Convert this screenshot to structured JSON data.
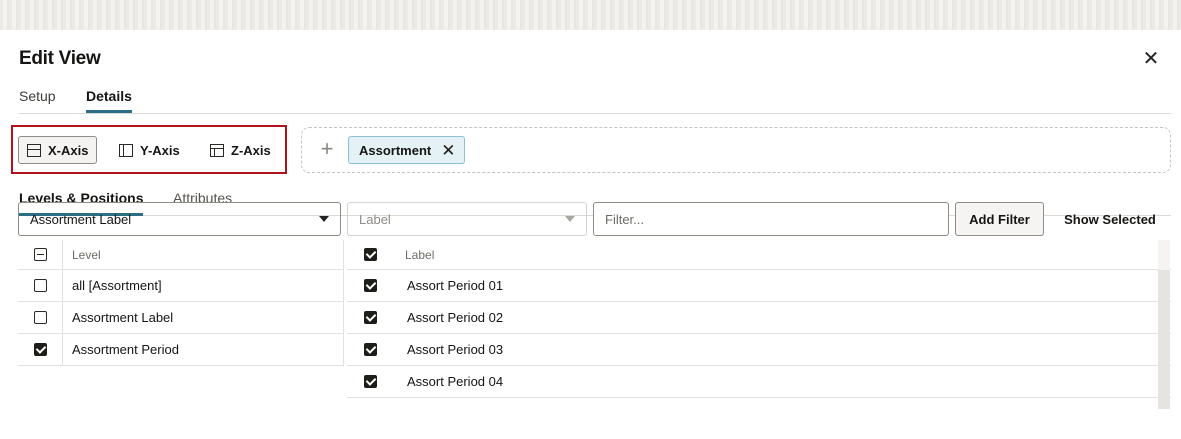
{
  "dialog": {
    "title": "Edit View",
    "close_symbol": "✕"
  },
  "main_tabs": [
    {
      "label": "Setup",
      "selected": false
    },
    {
      "label": "Details",
      "selected": true
    }
  ],
  "axis_buttons": [
    {
      "label": "X-Axis",
      "icon": "x-axis-layout-icon",
      "selected": true
    },
    {
      "label": "Y-Axis",
      "icon": "y-axis-layout-icon",
      "selected": false
    },
    {
      "label": "Z-Axis",
      "icon": "z-axis-layout-icon",
      "selected": false
    }
  ],
  "drop_zone": {
    "add_symbol": "+",
    "chips": [
      {
        "label": "Assortment",
        "remove_symbol": "✕"
      }
    ]
  },
  "sub_tabs": [
    {
      "label": "Levels & Positions",
      "selected": true
    },
    {
      "label": "Attributes",
      "selected": false
    }
  ],
  "controls": {
    "level_select_value": "Assortment Label",
    "label_select_value": "Label",
    "filter_placeholder": "Filter...",
    "add_filter_label": "Add Filter",
    "show_selected_label": "Show Selected"
  },
  "levels_grid": {
    "header": "Level",
    "header_checkbox": "indeterminate",
    "rows": [
      {
        "label": "all [Assortment]",
        "checked": false
      },
      {
        "label": "Assortment Label",
        "checked": false
      },
      {
        "label": "Assortment Period",
        "checked": true
      }
    ]
  },
  "positions_grid": {
    "header": "Label",
    "header_checkbox": "checked",
    "rows": [
      {
        "label": "Assort Period 01",
        "checked": true
      },
      {
        "label": "Assort Period 02",
        "checked": true
      },
      {
        "label": "Assort Period 03",
        "checked": true
      },
      {
        "label": "Assort Period 04",
        "checked": true
      }
    ]
  },
  "colors": {
    "highlight_border": "#b0121b",
    "tab_underline": "#2a6f86",
    "chip_background": "#e4f1f5"
  }
}
